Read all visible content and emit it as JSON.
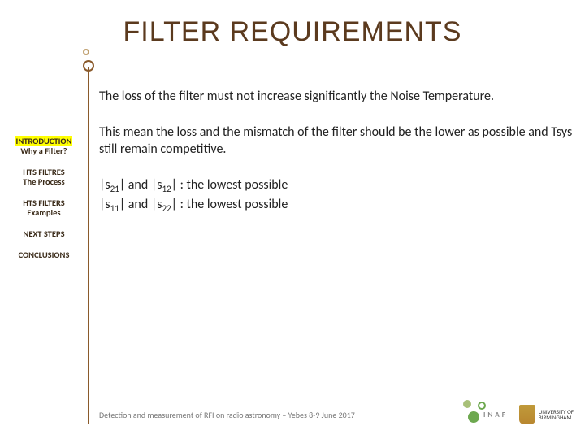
{
  "title": "FILTER REQUIREMENTS",
  "body": {
    "p1": "The loss of the filter must not increase significantly the Noise Temperature.",
    "p2": "This mean the loss and the mismatch of the filter should be the lower as possible and Tsys still remain competitive.",
    "sp": {
      "s21": "|s",
      "s21_sub": "21",
      "s21_rest": "| and |s",
      "s12_sub": "12",
      "s21_tail": "| : the lowest possible",
      "s11": "|s",
      "s11_sub": "11",
      "s11_rest": "| and |s",
      "s22_sub": "22",
      "s11_tail": "| : the lowest possible"
    }
  },
  "nav": {
    "items": [
      {
        "l1": "INTRODUCTION",
        "l2": "Why a Filter?",
        "active": true
      },
      {
        "l1": "HTS FILTRES",
        "l2": "The Process"
      },
      {
        "l1": "HTS FILTERS",
        "l2": "Examples"
      },
      {
        "l1": "NEXT STEPS",
        "l2": ""
      },
      {
        "l1": "CONCLUSIONS",
        "l2": ""
      }
    ]
  },
  "footer": {
    "text": "Detection and measurement of RFI on radio astronomy – Yebes 8-9 June 2017",
    "inaf": "INAF",
    "uob_l1": "UNIVERSITY OF",
    "uob_l2": "BIRMINGHAM"
  }
}
